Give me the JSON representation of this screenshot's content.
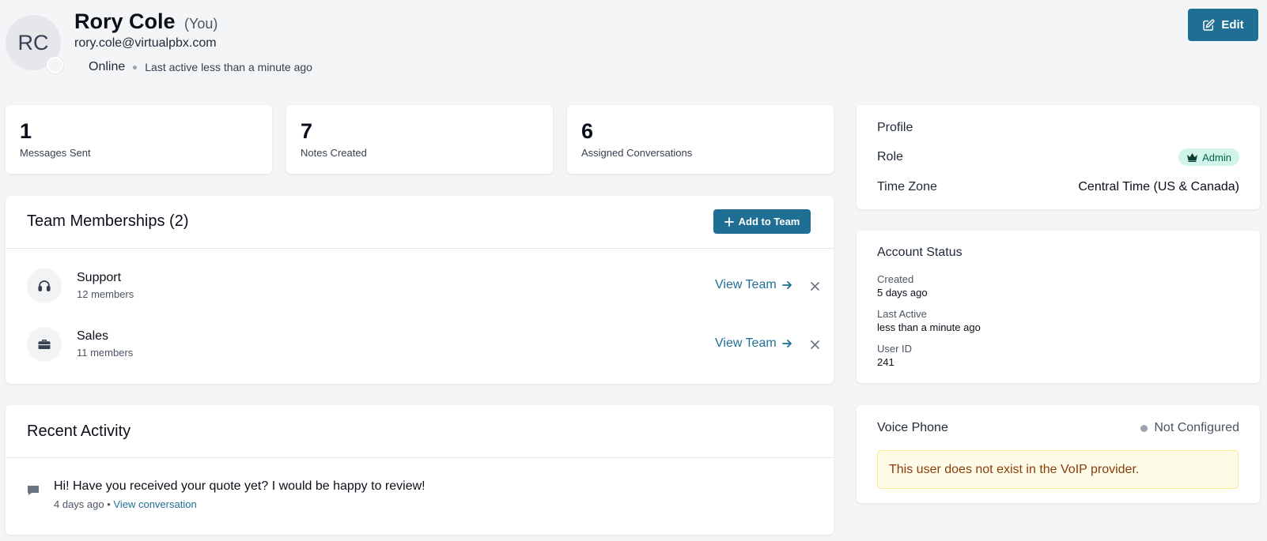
{
  "user": {
    "initials": "RC",
    "name": "Rory Cole",
    "you_label": "(You)",
    "email": "rory.cole@virtualpbx.com",
    "status": "Online",
    "last_active": "Last active less than a minute ago"
  },
  "header": {
    "edit_label": "Edit"
  },
  "stats": [
    {
      "value": "1",
      "label": "Messages Sent"
    },
    {
      "value": "7",
      "label": "Notes Created"
    },
    {
      "value": "6",
      "label": "Assigned Conversations"
    }
  ],
  "teams": {
    "title": "Team Memberships (2)",
    "add_label": "Add to Team",
    "view_label": "View Team",
    "items": [
      {
        "name": "Support",
        "members": "12 members",
        "icon": "headset-icon"
      },
      {
        "name": "Sales",
        "members": "11 members",
        "icon": "briefcase-icon"
      }
    ]
  },
  "activity": {
    "title": "Recent Activity",
    "items": [
      {
        "text": "Hi! Have you received your quote yet? I would be happy to review!",
        "time": "4 days ago",
        "separator": "•",
        "link": "View conversation"
      }
    ]
  },
  "profile": {
    "title": "Profile",
    "role_label": "Role",
    "role_value": "Admin",
    "tz_label": "Time Zone",
    "tz_value": "Central Time (US & Canada)"
  },
  "account": {
    "title": "Account Status",
    "created_label": "Created",
    "created_value": "5 days ago",
    "last_active_label": "Last Active",
    "last_active_value": "less than a minute ago",
    "user_id_label": "User ID",
    "user_id_value": "241"
  },
  "voice": {
    "title": "Voice Phone",
    "status": "Not Configured",
    "warning": "This user does not exist in the VoIP provider."
  },
  "colors": {
    "accent": "#1f6f94",
    "admin_badge_bg": "#d1f5ea",
    "warning_bg": "#fefce8",
    "warning_text": "#8a3b0b"
  }
}
